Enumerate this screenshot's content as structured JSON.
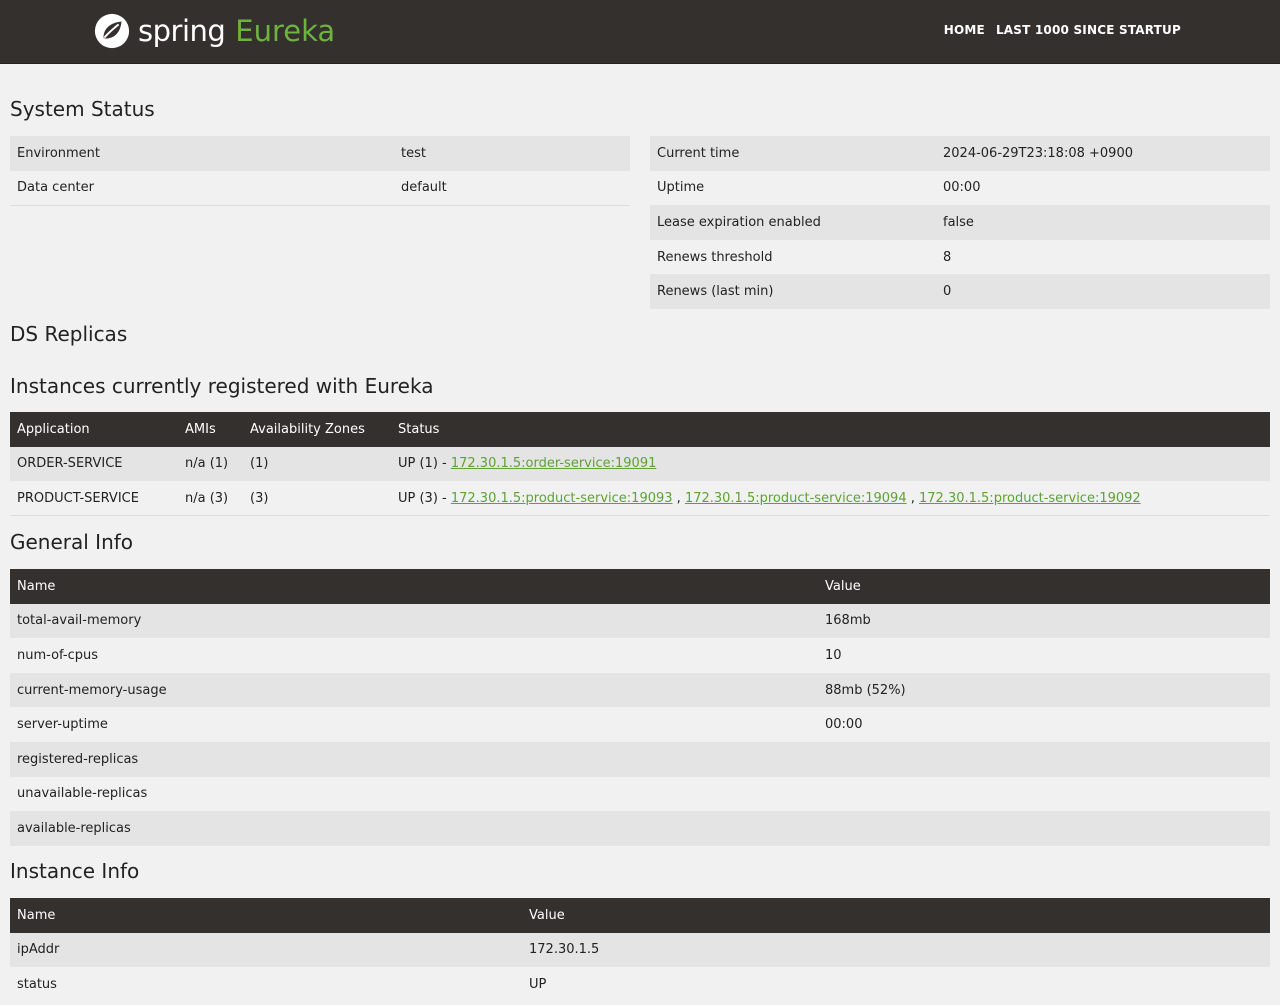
{
  "nav": {
    "brand_spring": "spring",
    "brand_eureka": "Eureka",
    "home": "HOME",
    "last1000": "LAST 1000 SINCE STARTUP"
  },
  "colors": {
    "navbar": "#34302d",
    "accent": "#6db33f",
    "link": "#5fa134",
    "background": "#f1f1f1",
    "row_shade": "#e4e4e4"
  },
  "system_status": {
    "title": "System Status",
    "left": [
      {
        "label": "Environment",
        "value": "test"
      },
      {
        "label": "Data center",
        "value": "default"
      }
    ],
    "right": [
      {
        "label": "Current time",
        "value": "2024-06-29T23:18:08 +0900"
      },
      {
        "label": "Uptime",
        "value": "00:00"
      },
      {
        "label": "Lease expiration enabled",
        "value": "false"
      },
      {
        "label": "Renews threshold",
        "value": "8"
      },
      {
        "label": "Renews (last min)",
        "value": "0"
      }
    ]
  },
  "ds_replicas": {
    "title": "DS Replicas"
  },
  "instances": {
    "title": "Instances currently registered with Eureka",
    "headers": [
      "Application",
      "AMIs",
      "Availability Zones",
      "Status"
    ],
    "rows": [
      {
        "application": "ORDER-SERVICE",
        "amis": "n/a (1)",
        "zones": "(1)",
        "status_prefix": "UP (1) - ",
        "links": [
          "172.30.1.5:order-service:19091"
        ]
      },
      {
        "application": "PRODUCT-SERVICE",
        "amis": "n/a (3)",
        "zones": "(3)",
        "status_prefix": "UP (3) - ",
        "links": [
          "172.30.1.5:product-service:19093",
          "172.30.1.5:product-service:19094",
          "172.30.1.5:product-service:19092"
        ]
      }
    ],
    "separator": " , "
  },
  "general_info": {
    "title": "General Info",
    "headers": [
      "Name",
      "Value"
    ],
    "rows": [
      {
        "name": "total-avail-memory",
        "value": "168mb"
      },
      {
        "name": "num-of-cpus",
        "value": "10"
      },
      {
        "name": "current-memory-usage",
        "value": "88mb (52%)"
      },
      {
        "name": "server-uptime",
        "value": "00:00"
      },
      {
        "name": "registered-replicas",
        "value": ""
      },
      {
        "name": "unavailable-replicas",
        "value": ""
      },
      {
        "name": "available-replicas",
        "value": ""
      }
    ]
  },
  "instance_info": {
    "title": "Instance Info",
    "headers": [
      "Name",
      "Value"
    ],
    "rows": [
      {
        "name": "ipAddr",
        "value": "172.30.1.5"
      },
      {
        "name": "status",
        "value": "UP"
      }
    ]
  }
}
